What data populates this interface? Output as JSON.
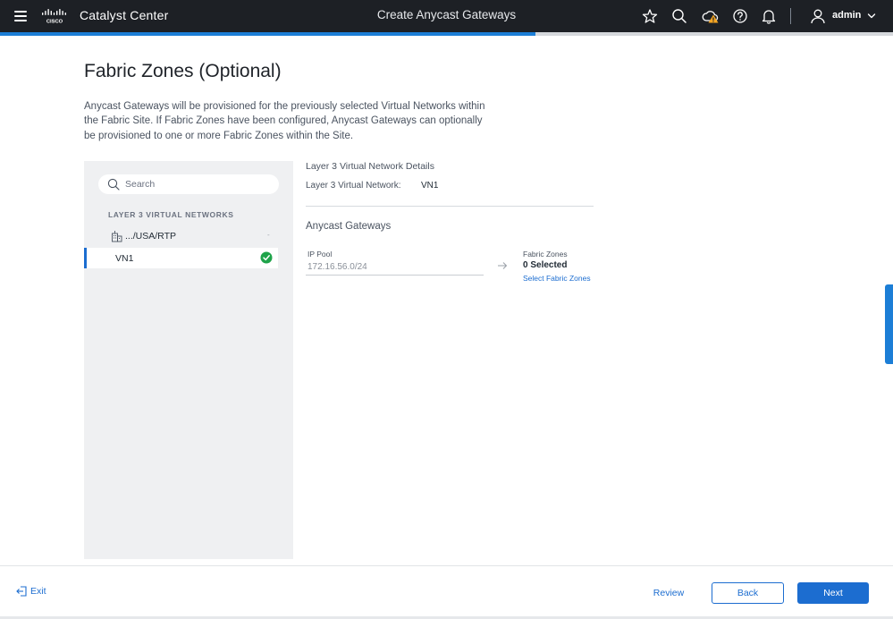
{
  "header": {
    "app_name": "Catalyst Center",
    "page_title": "Create Anycast Gateways",
    "user_name": "admin",
    "icons": [
      "menu-icon",
      "cisco-logo",
      "star-icon",
      "search-icon",
      "cloud-warning-icon",
      "help-icon",
      "bell-icon",
      "user-icon",
      "chevron-down-icon"
    ],
    "warning_color": "#f5a623"
  },
  "progress": {
    "fraction": 0.6,
    "color": "#1c7ed6"
  },
  "main": {
    "title": "Fabric Zones (Optional)",
    "description": "Anycast Gateways will be provisioned for the previously selected Virtual Networks within the Fabric Site. If Fabric Zones have been configured, Anycast Gateways can optionally be provisioned to one or more Fabric Zones within the Site."
  },
  "sidebar": {
    "search_placeholder": "Search",
    "section_label": "LAYER 3 VIRTUAL NETWORKS",
    "site_label": ".../USA/RTP",
    "site_caret": "-",
    "items": [
      {
        "label": "VN1",
        "selected": true,
        "status": "complete",
        "status_color": "#1fa34a"
      }
    ]
  },
  "details": {
    "section_title": "Layer 3 Virtual Network Details",
    "vn_label": "Layer 3 Virtual Network:",
    "vn_value": "VN1",
    "gateways_title": "Anycast Gateways",
    "ip_pool_label": "IP Pool",
    "ip_pool_value": "172.16.56.0/24",
    "fabric_zones_label": "Fabric Zones",
    "fabric_zones_count": "0 Selected",
    "select_link": "Select Fabric Zones"
  },
  "footer": {
    "exit_label": "Exit",
    "review_label": "Review",
    "back_label": "Back",
    "next_label": "Next",
    "accent_color": "#1c6dd0"
  }
}
